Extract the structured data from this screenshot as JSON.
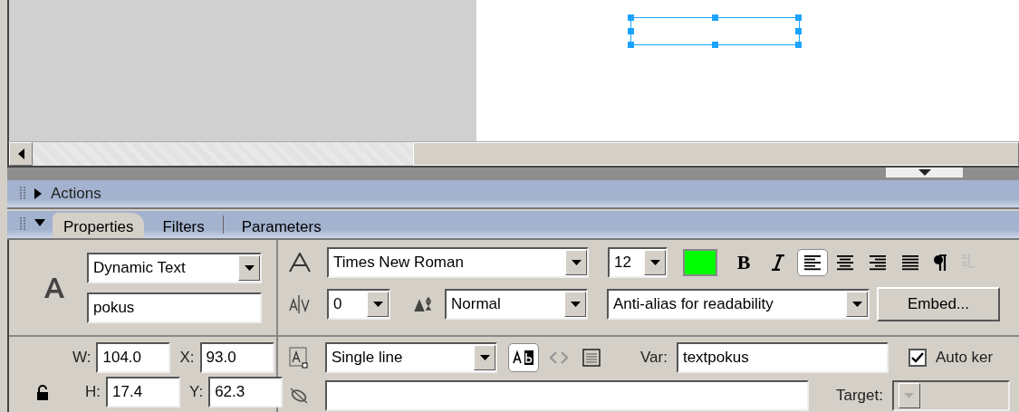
{
  "actions_panel": {
    "title": "Actions",
    "expanded": false
  },
  "properties_panel": {
    "expanded": true,
    "tabs": [
      {
        "label": "Properties",
        "selected": true
      },
      {
        "label": "Filters",
        "selected": false
      },
      {
        "label": "Parameters",
        "selected": false
      }
    ]
  },
  "text_type": "Dynamic Text",
  "instance_name": "pokus",
  "font": "Times New Roman",
  "font_size": "12",
  "text_color": {
    "color": "#00ff00"
  },
  "bold": {
    "label": "B",
    "selected": false
  },
  "italic": false,
  "alignment": [
    {
      "kind": "left",
      "selected": true
    },
    {
      "kind": "center",
      "selected": false
    },
    {
      "kind": "right",
      "selected": false
    },
    {
      "kind": "justify",
      "selected": false
    }
  ],
  "letter_spacing": "0",
  "character_position": "Normal",
  "anti_alias": "Anti-alias for readability",
  "embed_button": "Embed...",
  "width": {
    "label": "W:",
    "value": "104.0"
  },
  "x": {
    "label": "X:",
    "value": "93.0"
  },
  "height": {
    "label": "H:",
    "value": "17.4"
  },
  "y": {
    "label": "Y:",
    "value": "62.3"
  },
  "line_type": "Single line",
  "selectable": true,
  "var": {
    "label": "Var:",
    "value": "textpokus"
  },
  "auto_kern": {
    "label": "Auto ker",
    "checked": true
  },
  "target": {
    "label": "Target:",
    "disabled": true
  }
}
